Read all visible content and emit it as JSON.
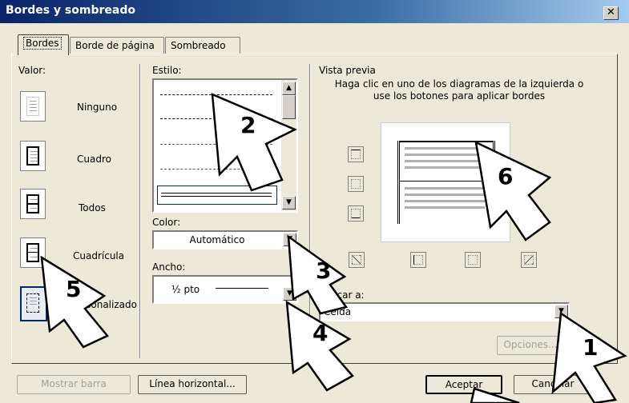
{
  "window": {
    "title": "Bordes y sombreado",
    "close_glyph": "✕"
  },
  "tabs": [
    {
      "label": "Bordes",
      "active": true
    },
    {
      "label": "Borde de página",
      "active": false
    },
    {
      "label": "Sombreado",
      "active": false
    }
  ],
  "settings": {
    "label": "Valor:",
    "items": [
      {
        "label": "Ninguno",
        "icon": "setting-none-icon"
      },
      {
        "label": "Cuadro",
        "icon": "setting-box-icon"
      },
      {
        "label": "Todos",
        "icon": "setting-all-icon"
      },
      {
        "label": "Cuadrícula",
        "icon": "setting-grid-icon"
      },
      {
        "label": "Personalizado",
        "icon": "setting-custom-icon"
      }
    ]
  },
  "style": {
    "label": "Estilo:"
  },
  "color": {
    "label": "Color:",
    "value": "Automático"
  },
  "width": {
    "label": "Ancho:",
    "value": "½ pto"
  },
  "preview": {
    "label": "Vista previa",
    "hint": "Haga clic en uno de los diagramas de la izquierda o use los botones para aplicar bordes"
  },
  "apply": {
    "label": "Aplicar a:",
    "value": "Celda"
  },
  "buttons": {
    "options": "Opciones...",
    "show_toolbar": "Mostrar barra",
    "horizontal_line": "Línea horizontal...",
    "accept": "Aceptar",
    "cancel": "Cancelar"
  },
  "callouts": [
    "1",
    "2",
    "3",
    "4",
    "5",
    "6"
  ]
}
